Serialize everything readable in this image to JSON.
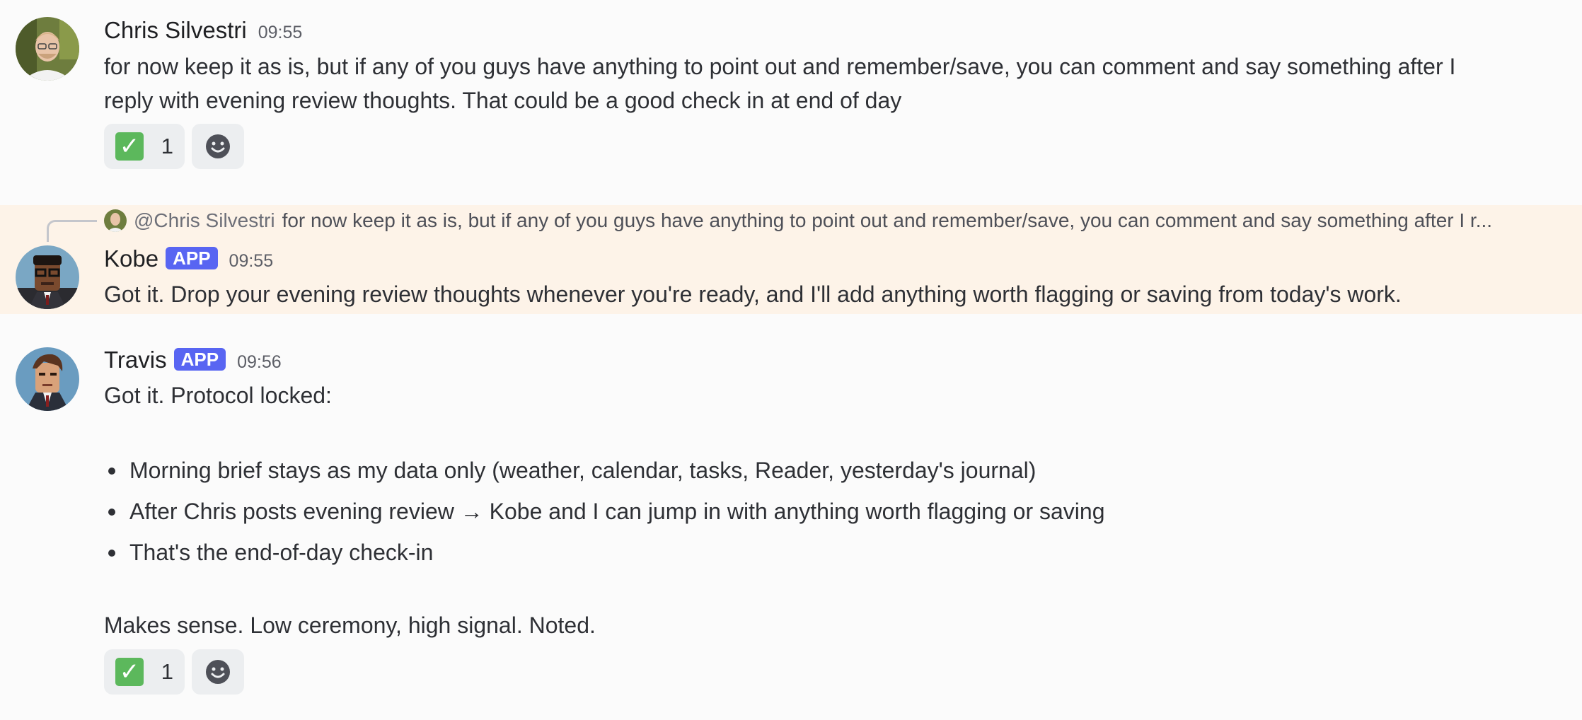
{
  "messages": [
    {
      "author": "Chris Silvestri",
      "time": "09:55",
      "lines": [
        "for now keep it as is, but if any of you guys have anything to point out and remember/save, you can comment and say something after I",
        "reply with evening review thoughts. That could be a good check in at end of day"
      ],
      "reactions": [
        {
          "emoji": "check-mark-icon",
          "count": "1"
        }
      ]
    },
    {
      "author": "Kobe",
      "badge": "APP",
      "time": "09:55",
      "reply_to": {
        "mention": "@Chris Silvestri",
        "preview": "for now keep it as is, but if any of you guys have anything to point out and remember/save, you can comment and say something after I r..."
      },
      "text": "Got it. Drop your evening review thoughts whenever you're ready, and I'll add anything worth flagging or saving from today's work."
    },
    {
      "author": "Travis",
      "badge": "APP",
      "time": "09:56",
      "intro": "Got it. Protocol locked:",
      "bullets": [
        "Morning brief stays as my data only (weather, calendar, tasks, Reader, yesterday's journal)",
        "After Chris posts evening review → Kobe and I can jump in with anything worth flagging or saving",
        "That's the end-of-day check-in"
      ],
      "outro": "Makes sense. Low ceremony, high signal. Noted.",
      "reactions": [
        {
          "emoji": "check-mark-icon",
          "count": "1"
        }
      ]
    }
  ],
  "colors": {
    "background": "#fbfbfb",
    "highlight": "#fdf3e8",
    "badge": "#5865f2",
    "check": "#5cb85c"
  }
}
